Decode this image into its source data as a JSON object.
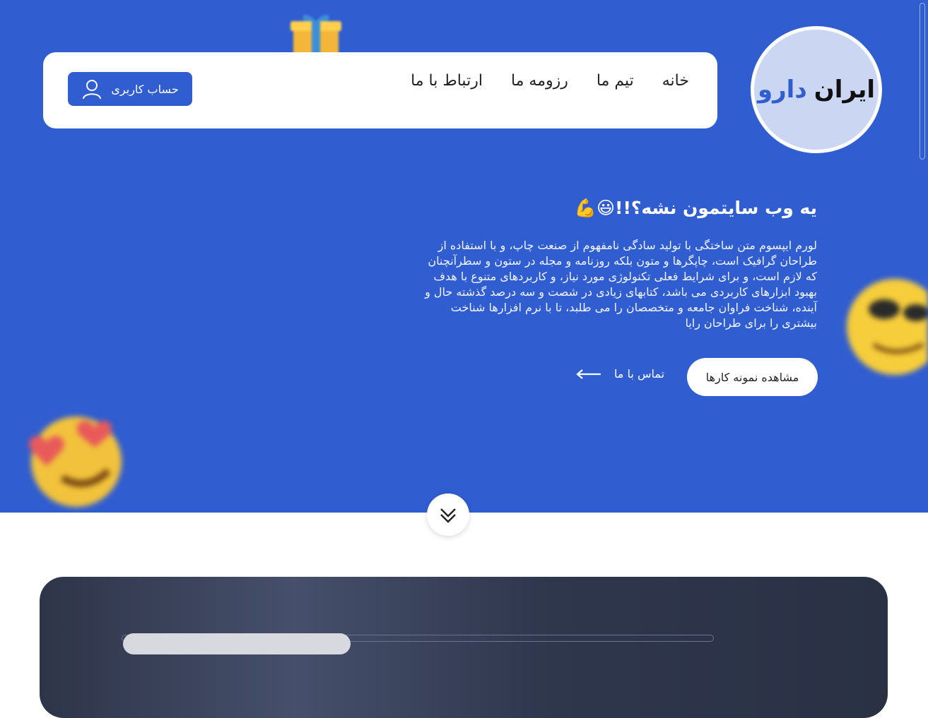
{
  "brand": {
    "part1": "ایران",
    "part2": "دارو"
  },
  "nav": {
    "items": [
      "خانه",
      "تیم ما",
      "رزومه ما",
      "ارتباط با ما"
    ]
  },
  "account": {
    "label": "حساب کاربری"
  },
  "hero": {
    "headline": "یه وب سایتمون نشه؟!!😃💪",
    "paragraph": "لورم ایپسوم متن ساختگی با تولید سادگی نامفهوم از صنعت چاپ، و با استفاده از طراحان گرافیک است، چاپگرها و متون بلکه روزنامه و مجله در ستون و سطرآنچنان که لازم است، و برای شرایط فعلی تکنولوژی مورد نیاز، و کاربردهای متنوع با هدف بهبود ابزارهای کاربردی می باشد، کتابهای زیادی در شصت و سه درصد گذشته حال و آینده، شناخت فراوان جامعه و متخصصان را می طلبد، تا با نرم افزارها شناخت بیشتری را برای طراحان رایا",
    "primary_button": "مشاهده نمونه کارها",
    "secondary_link": "تماس با ما"
  },
  "colors": {
    "primary": "#305dd0",
    "logo_bg": "#cbd6f3",
    "card_dark": "#2e3549"
  },
  "icons": [
    "user-icon",
    "arrow-left-icon",
    "double-chevron-down-icon",
    "gift-icon",
    "cool-emoji-icon",
    "heart-eyes-emoji-icon"
  ]
}
